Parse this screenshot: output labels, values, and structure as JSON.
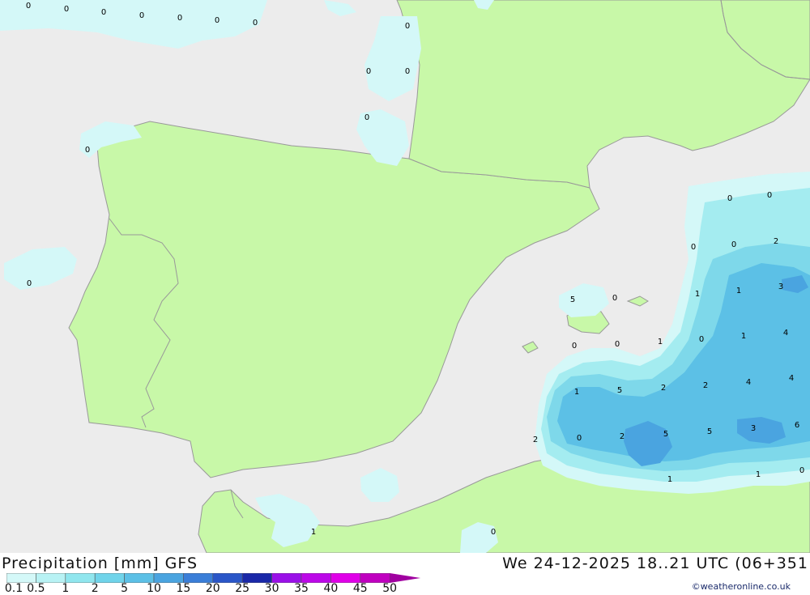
{
  "title": {
    "left": "Precipitation [mm] GFS",
    "right": "We 24-12-2025 18..21 UTC (06+351"
  },
  "credit": "©weatheronline.co.uk",
  "colors": {
    "sea": "#ececec",
    "land": "#c8f8a8",
    "border": "#999999",
    "p_0_1": "#d4f8f8",
    "p_0_5": "#b8f2f4",
    "p_1": "#a4ecf0",
    "p_2": "#7ed8ea",
    "p_5": "#5cc0e6",
    "p_10": "#4aa4e0"
  },
  "legend": {
    "ticks": [
      "0.1",
      "0.5",
      "1",
      "2",
      "5",
      "10",
      "15",
      "20",
      "25",
      "30",
      "35",
      "40",
      "45",
      "50"
    ],
    "colors": [
      "#d4f8f8",
      "#b8f2f4",
      "#90e6ee",
      "#70d4ea",
      "#5cc0e6",
      "#4aa4e0",
      "#3a7ed8",
      "#2a56c8",
      "#1a28a8",
      "#9a10e8",
      "#bc08e8",
      "#e000e8",
      "#c000c0",
      "#a000a0"
    ]
  },
  "values": [
    "0",
    "0",
    "0",
    "0",
    "0",
    "0",
    "0",
    "0",
    "0",
    "0",
    "0",
    "0",
    "0",
    "0",
    "0",
    "0",
    "0",
    "2",
    "1",
    "1",
    "3",
    "5",
    "0",
    "0",
    "0",
    "1",
    "0",
    "1",
    "4",
    "1",
    "5",
    "2",
    "2",
    "4",
    "4",
    "2",
    "0",
    "2",
    "5",
    "5",
    "3",
    "6",
    "1",
    "0",
    "1",
    "1",
    "0",
    "0"
  ]
}
